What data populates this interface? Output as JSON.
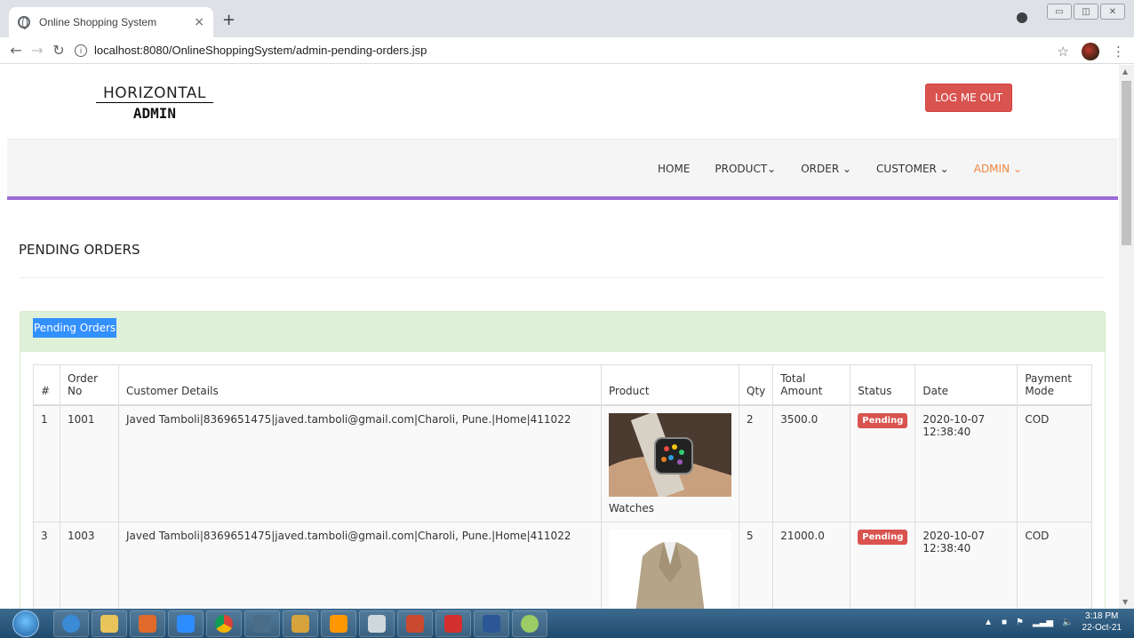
{
  "browser": {
    "tab_title": "Online Shopping System",
    "tab_close": "×",
    "new_tab": "+",
    "url": "localhost:8080/OnlineShoppingSystem/admin-pending-orders.jsp",
    "window_controls": [
      "▭",
      "◫",
      "✕"
    ]
  },
  "header": {
    "logo_line1": "HORIZONTAL",
    "logo_line2": "ADMIN",
    "logout_label": "LOG ME OUT"
  },
  "nav": {
    "items": [
      {
        "label": "HOME"
      },
      {
        "label": "PRODUCT⌄"
      },
      {
        "label": "ORDER ⌄"
      },
      {
        "label": "CUSTOMER ⌄"
      },
      {
        "label": "ADMIN ⌄"
      }
    ]
  },
  "main": {
    "title": "PENDING ORDERS",
    "panel_title": "Pending Orders",
    "columns": [
      "#",
      "Order No",
      "Customer Details",
      "Product",
      "Qty",
      "Total Amount",
      "Status",
      "Date",
      "Payment Mode"
    ],
    "rows": [
      {
        "num": "1",
        "order_no": "1001",
        "customer": "Javed Tamboli|8369651475|javed.tamboli@gmail.com|Charoli, Pune.|Home|411022",
        "product": "Watches",
        "qty": "2",
        "amount": "3500.0",
        "status": "Pending",
        "date": "2020-10-07 12:38:40",
        "payment": "COD"
      },
      {
        "num": "3",
        "order_no": "1003",
        "customer": "Javed Tamboli|8369651475|javed.tamboli@gmail.com|Charoli, Pune.|Home|411022",
        "product": "",
        "qty": "5",
        "amount": "21000.0",
        "status": "Pending",
        "date": "2020-10-07 12:38:40",
        "payment": "COD"
      }
    ]
  },
  "taskbar": {
    "time": "3:18 PM",
    "date": "22-Oct-21"
  },
  "colors": {
    "accent_purple": "#9b6bd6",
    "logout_red": "#d9534f",
    "panel_green": "#dff0d8",
    "nav_active_orange": "#f0883e"
  }
}
